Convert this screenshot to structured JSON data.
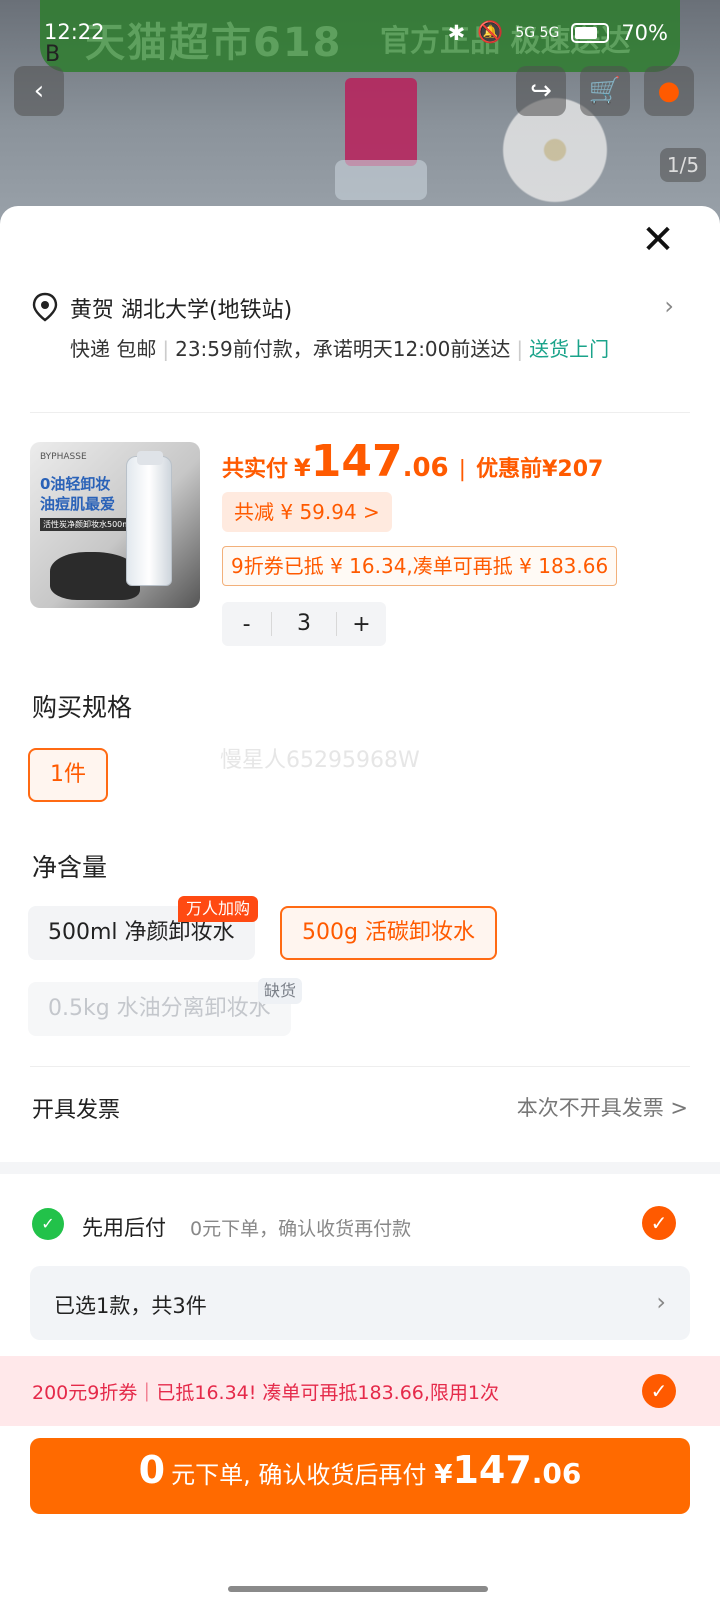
{
  "status_bar": {
    "time": "12:22",
    "network": "5G 5G",
    "battery": "70%"
  },
  "hero": {
    "banner_text": "天猫超市618",
    "banner_text2": "官方正品 极速送达",
    "brand_letter": "B",
    "page_indicator": "1/5"
  },
  "address": {
    "text": "黄贺 湖北大学(地铁站)"
  },
  "delivery": {
    "method": "快递 包邮",
    "time_text": "23:59前付款，承诺明天12:00前送达",
    "door": "送货上门"
  },
  "product": {
    "thumb_brand": "BYPHASSE",
    "thumb_slogan": "0油轻卸妆\n油痘肌最爱",
    "thumb_sub": "活性炭净颜卸妆水500ml"
  },
  "price": {
    "label": "共实付",
    "currency": "¥",
    "int": "147",
    "dec": ".06",
    "original_label": "优惠前",
    "original": "¥207",
    "reduce": "共减 ¥ 59.94 >",
    "coupon": "9折券已抵 ¥ 16.34,凑单可再抵 ¥ 183.66"
  },
  "stepper": {
    "minus": "-",
    "qty": "3",
    "plus": "+"
  },
  "spec": {
    "title": "购买规格",
    "option": "1件",
    "watermark": "慢星人65295968W"
  },
  "volume": {
    "title": "净含量",
    "options": [
      {
        "label": "500ml 净颜卸妆水",
        "tag": "万人加购"
      },
      {
        "label": "500g 活碳卸妆水"
      },
      {
        "label": "0.5kg 水油分离卸妆水",
        "tag": "缺货"
      }
    ]
  },
  "invoice": {
    "label": "开具发票",
    "value": "本次不开具发票 >"
  },
  "pay_later": {
    "title": "先用后付",
    "desc": "0元下单，确认收货再付款"
  },
  "selected": {
    "text": "已选1款，共3件"
  },
  "promo": {
    "text": "200元9折券｜已抵16.34! 凑单可再抵183.66,限用1次"
  },
  "cta": {
    "zero": "0",
    "text": "元下单, 确认收货后再付",
    "cur": "¥",
    "int": "147",
    "dec": ".06"
  },
  "colors": {
    "accent": "#ff6a00",
    "green": "#22c24a",
    "promo_text": "#e52a4a"
  }
}
